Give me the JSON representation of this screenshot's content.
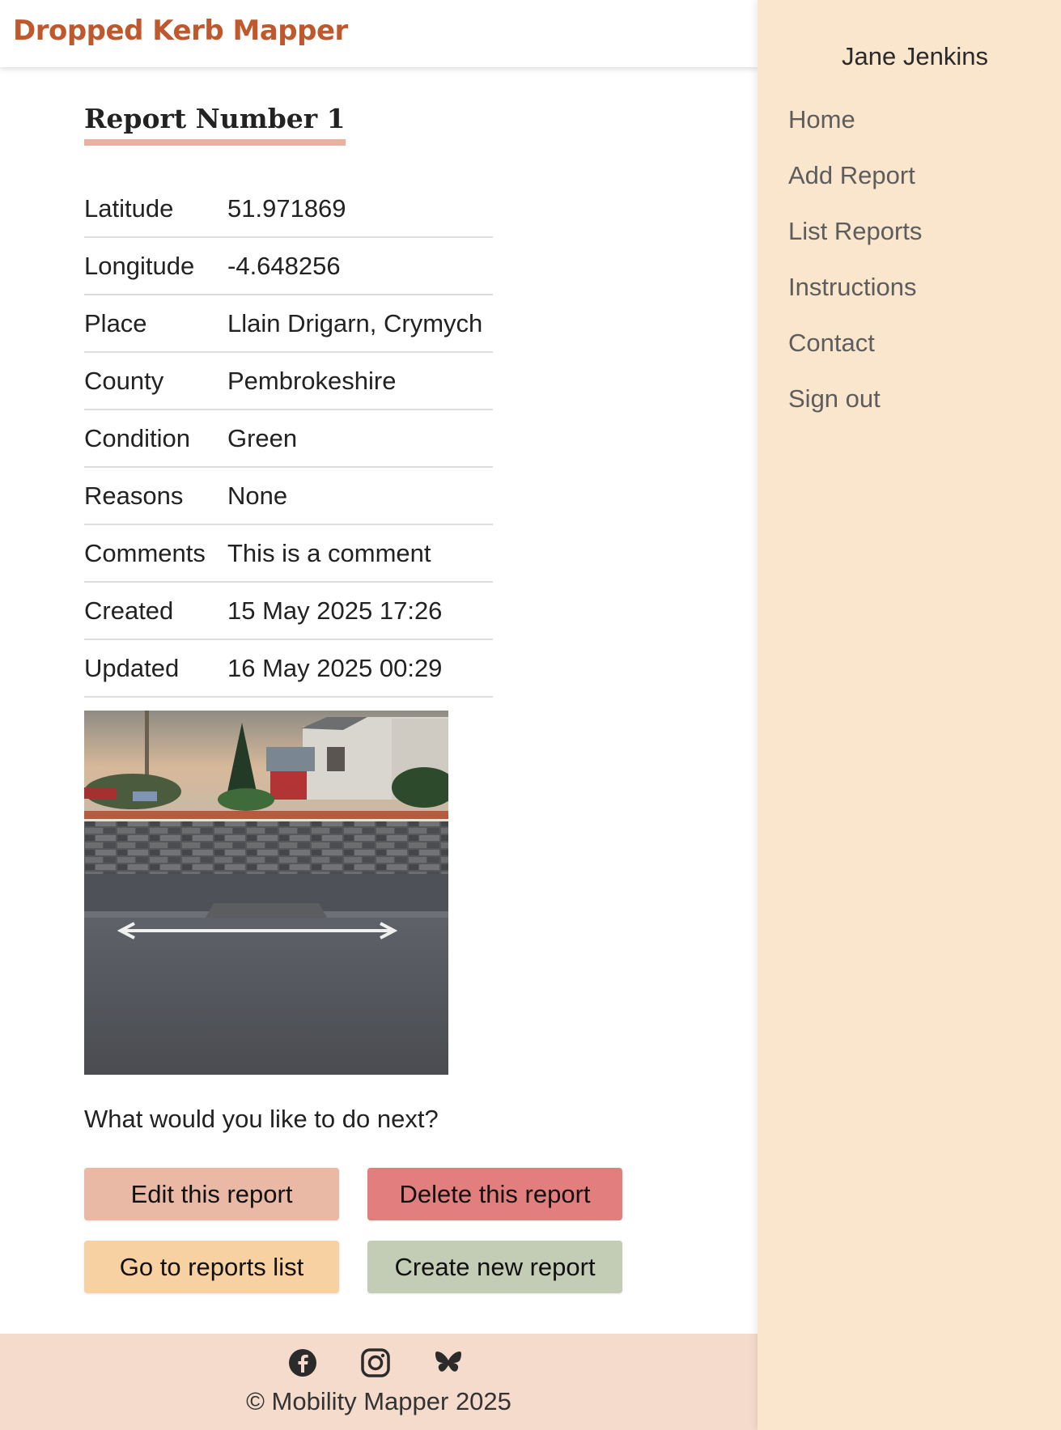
{
  "header": {
    "logo_text": "Dropped Kerb Mapper"
  },
  "sidebar": {
    "user_name": "Jane Jenkins",
    "nav": [
      {
        "label": "Home"
      },
      {
        "label": "Add Report"
      },
      {
        "label": "List Reports"
      },
      {
        "label": "Instructions"
      },
      {
        "label": "Contact"
      },
      {
        "label": "Sign out"
      }
    ]
  },
  "report": {
    "title": "Report Number 1",
    "fields": [
      {
        "label": "Latitude",
        "value": "51.971869"
      },
      {
        "label": "Longitude",
        "value": "-4.648256"
      },
      {
        "label": "Place",
        "value": "Llain Drigarn, Crymych"
      },
      {
        "label": "County",
        "value": "Pembrokeshire"
      },
      {
        "label": "Condition",
        "value": "Green"
      },
      {
        "label": "Reasons",
        "value": "None"
      },
      {
        "label": "Comments",
        "value": "This is a comment"
      },
      {
        "label": "Created",
        "value": "15 May 2025 17:26"
      },
      {
        "label": "Updated",
        "value": "16 May 2025 00:29"
      }
    ]
  },
  "actions": {
    "prompt": "What would you like to do next?",
    "edit_label": "Edit this report",
    "delete_label": "Delete this report",
    "list_label": "Go to reports list",
    "create_label": "Create new report"
  },
  "footer": {
    "social_icons": [
      "facebook-icon",
      "instagram-icon",
      "bluesky-icon"
    ],
    "copyright": "© Mobility Mapper 2025"
  },
  "colors": {
    "brand": "#c0582e",
    "sidebar_bg": "#fae5cd",
    "footer_bg": "#f5dbcc",
    "title_underline": "#e7b09f",
    "edit_button": "#e9b9a6",
    "delete_button": "#e37e7e",
    "list_button": "#f8d1a2",
    "create_button": "#c3cdb6"
  }
}
